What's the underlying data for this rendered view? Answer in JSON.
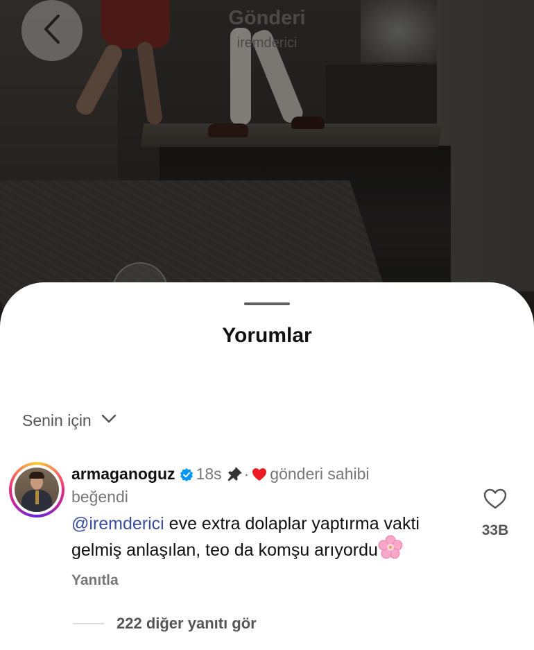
{
  "header": {
    "title": "Gönderi",
    "subtitle": "iremderici"
  },
  "sheet": {
    "title": "Yorumlar",
    "filter_label": "Senin için"
  },
  "comment": {
    "username": "armaganoguz",
    "time": "18s",
    "separator": "·",
    "liked_by_owner_line1": "gönderi sahibi",
    "liked_by_owner_line2": "beğendi",
    "mention": "@iremderici",
    "text": " eve extra dolaplar yaptırma vakti gelmiş anlaşılan, teo da komşu arıyordu",
    "emoji": "🌸",
    "reply_label": "Yanıtla",
    "like_count": "33B",
    "more_replies": "222 diğer yanıtı gör"
  },
  "colors": {
    "verified": "#0095f6",
    "owner_heart": "#ed1c24",
    "mention": "#3a4d9e"
  },
  "icons": {
    "back": "chevron-left-icon",
    "filter": "chevron-down-icon",
    "verified": "verified-badge-icon",
    "pinned": "pin-icon",
    "owner_liked": "heart-filled-icon",
    "like": "heart-outline-icon"
  }
}
